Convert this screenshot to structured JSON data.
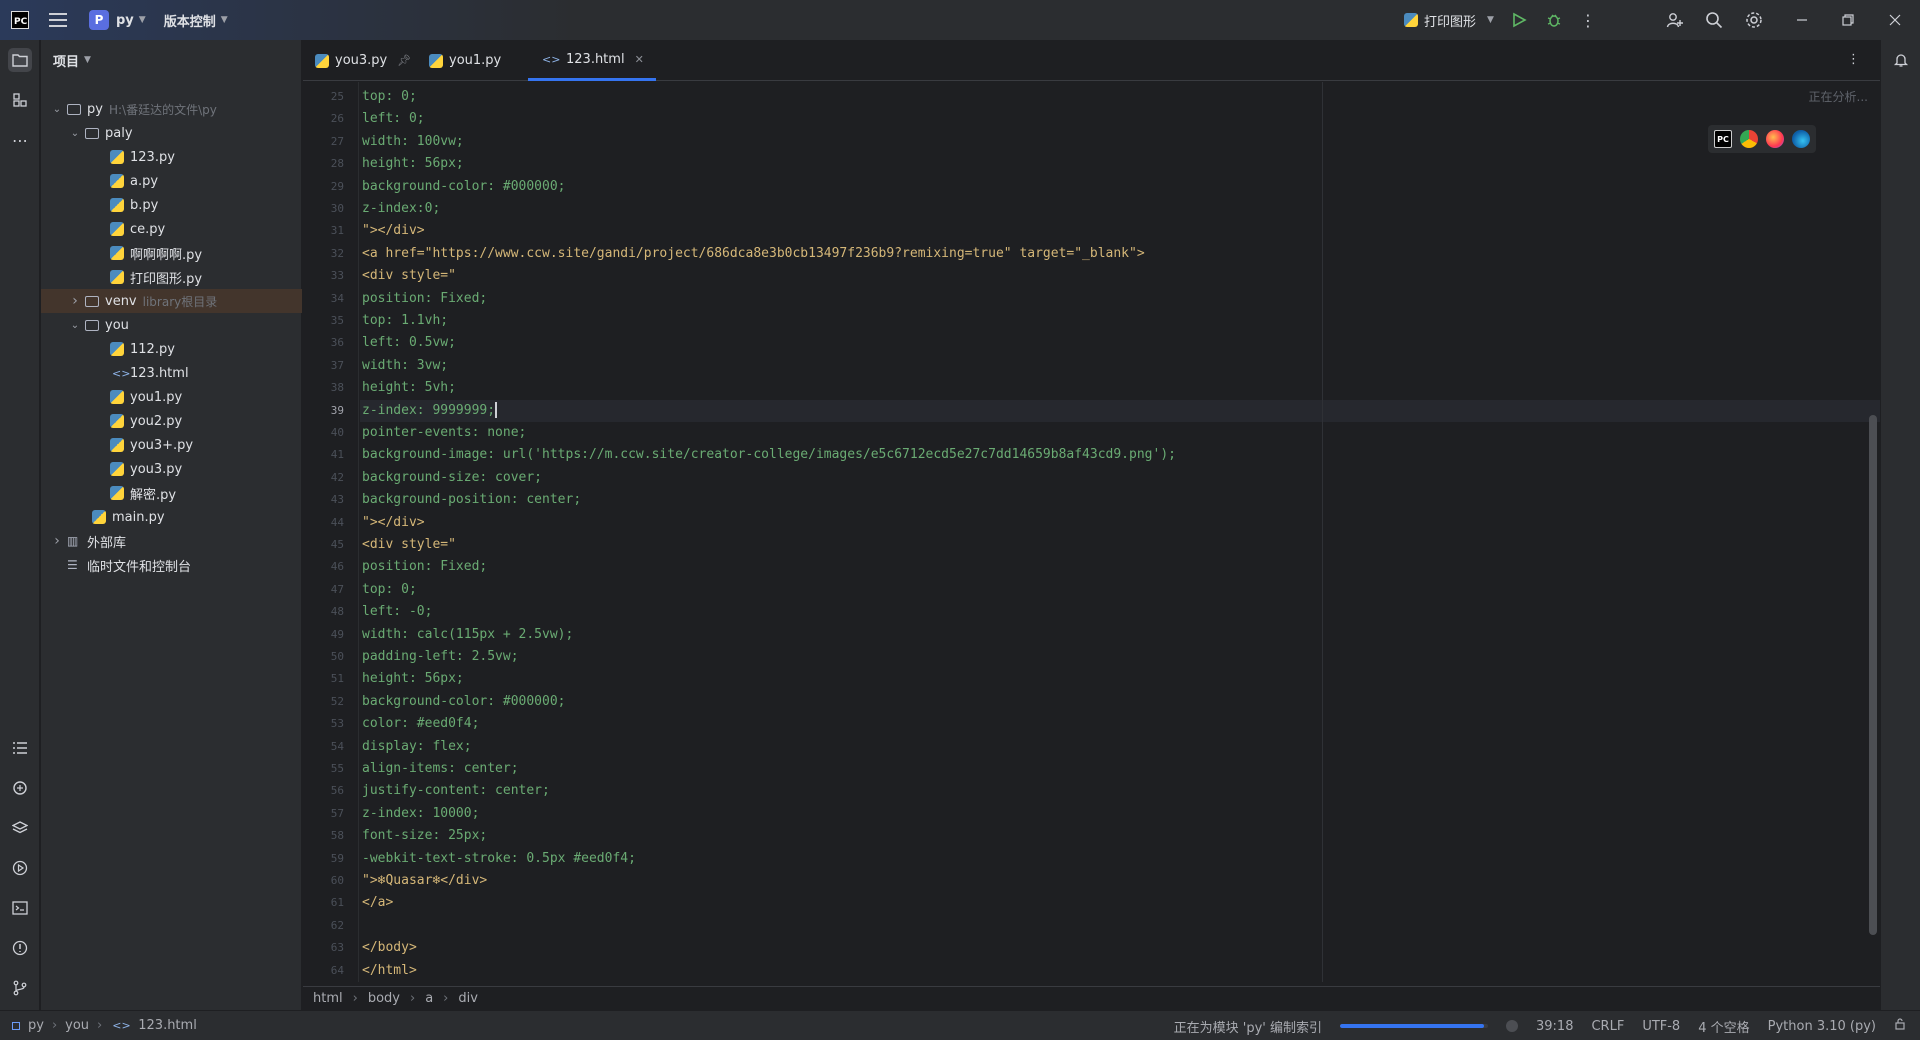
{
  "titlebar": {
    "app_logo": "PC",
    "project_badge": "P",
    "project_name": "py",
    "vcs_label": "版本控制",
    "run_config": "打印图形"
  },
  "project_panel": {
    "title": "项目",
    "tree": [
      {
        "label": "py",
        "hint": "H:\\番廷达的文件\\py",
        "kind": "folder",
        "expanded": true
      },
      {
        "label": "paly",
        "hint": "",
        "kind": "folder",
        "expanded": true
      },
      {
        "label": "123.py",
        "hint": "",
        "kind": "py"
      },
      {
        "label": "a.py",
        "hint": "",
        "kind": "py"
      },
      {
        "label": "b.py",
        "hint": "",
        "kind": "py"
      },
      {
        "label": "ce.py",
        "hint": "",
        "kind": "py"
      },
      {
        "label": "啊啊啊啊.py",
        "hint": "",
        "kind": "py"
      },
      {
        "label": "打印图形.py",
        "hint": "",
        "kind": "py"
      },
      {
        "label": "venv",
        "hint": "library根目录",
        "kind": "folder",
        "expanded": false,
        "selected": true
      },
      {
        "label": "you",
        "hint": "",
        "kind": "folder",
        "expanded": true
      },
      {
        "label": "112.py",
        "hint": "",
        "kind": "py"
      },
      {
        "label": "123.html",
        "hint": "",
        "kind": "html"
      },
      {
        "label": "you1.py",
        "hint": "",
        "kind": "py"
      },
      {
        "label": "you2.py",
        "hint": "",
        "kind": "py"
      },
      {
        "label": "you3+.py",
        "hint": "",
        "kind": "py"
      },
      {
        "label": "you3.py",
        "hint": "",
        "kind": "py"
      },
      {
        "label": "解密.py",
        "hint": "",
        "kind": "py"
      },
      {
        "label": "main.py",
        "hint": "",
        "kind": "py"
      },
      {
        "label": "外部库",
        "hint": "",
        "kind": "lib",
        "expanded": false
      },
      {
        "label": "临时文件和控制台",
        "hint": "",
        "kind": "scratch"
      }
    ]
  },
  "tabs": [
    {
      "label": "you3.py",
      "kind": "py",
      "pinned": true,
      "active": false
    },
    {
      "label": "you1.py",
      "kind": "py",
      "pinned": false,
      "active": false
    },
    {
      "label": "123.html",
      "kind": "html",
      "pinned": false,
      "active": true
    }
  ],
  "editor": {
    "analyzing": "正在分析...",
    "current_line": 39,
    "lines": [
      {
        "n": 25,
        "text": "top: 0;"
      },
      {
        "n": 26,
        "text": "left: 0;"
      },
      {
        "n": 27,
        "text": "width: 100vw;"
      },
      {
        "n": 28,
        "text": "height: 56px;"
      },
      {
        "n": 29,
        "text": "background-color: #000000;"
      },
      {
        "n": 30,
        "text": "z-index:0;"
      },
      {
        "n": 31,
        "text": "\"></div>"
      },
      {
        "n": 32,
        "text": "<a href=\"https://www.ccw.site/gandi/project/686dca8e3b0cb13497f236b9?remixing=true\" target=\"_blank\">"
      },
      {
        "n": 33,
        "text": "<div style=\""
      },
      {
        "n": 34,
        "text": "position: Fixed;"
      },
      {
        "n": 35,
        "text": "top: 1.1vh;"
      },
      {
        "n": 36,
        "text": "left: 0.5vw;"
      },
      {
        "n": 37,
        "text": "width: 3vw;"
      },
      {
        "n": 38,
        "text": "height: 5vh;"
      },
      {
        "n": 39,
        "text": "z-index: 9999999;"
      },
      {
        "n": 40,
        "text": "pointer-events: none;"
      },
      {
        "n": 41,
        "text": "background-image: url('https://m.ccw.site/creator-college/images/e5c6712ecd5e27c7dd14659b8af43cd9.png');"
      },
      {
        "n": 42,
        "text": "background-size: cover;"
      },
      {
        "n": 43,
        "text": "background-position: center;"
      },
      {
        "n": 44,
        "text": "\"></div>"
      },
      {
        "n": 45,
        "text": "<div style=\""
      },
      {
        "n": 46,
        "text": "position: Fixed;"
      },
      {
        "n": 47,
        "text": "top: 0;"
      },
      {
        "n": 48,
        "text": "left: -0;"
      },
      {
        "n": 49,
        "text": "width: calc(115px + 2.5vw);"
      },
      {
        "n": 50,
        "text": "padding-left: 2.5vw;"
      },
      {
        "n": 51,
        "text": "height: 56px;"
      },
      {
        "n": 52,
        "text": "background-color: #000000;"
      },
      {
        "n": 53,
        "text": "color: #eed0f4;"
      },
      {
        "n": 54,
        "text": "display: flex;"
      },
      {
        "n": 55,
        "text": "align-items: center;"
      },
      {
        "n": 56,
        "text": "justify-content: center;"
      },
      {
        "n": 57,
        "text": "z-index: 10000;"
      },
      {
        "n": 58,
        "text": "font-size: 25px;"
      },
      {
        "n": 59,
        "text": "-webkit-text-stroke: 0.5px #eed0f4;"
      },
      {
        "n": 60,
        "text": "\">❄Quasar❄</div>"
      },
      {
        "n": 61,
        "text": "</a>"
      },
      {
        "n": 62,
        "text": ""
      },
      {
        "n": 63,
        "text": "</body>"
      },
      {
        "n": 64,
        "text": "</html>"
      }
    ]
  },
  "breadcrumbs": [
    "html",
    "body",
    "a",
    "div"
  ],
  "status": {
    "path": [
      "py",
      "you",
      "123.html"
    ],
    "indexing": "正在为模块 'py' 编制索引",
    "indexing_progress": 0.97,
    "position": "39:18",
    "line_sep": "CRLF",
    "encoding": "UTF-8",
    "indent": "4 个空格",
    "interpreter": "Python 3.10 (py)"
  },
  "colors": {
    "accent": "#3574f0",
    "selection": "#43352c",
    "string": "#6aab73",
    "tag": "#d5b778"
  }
}
